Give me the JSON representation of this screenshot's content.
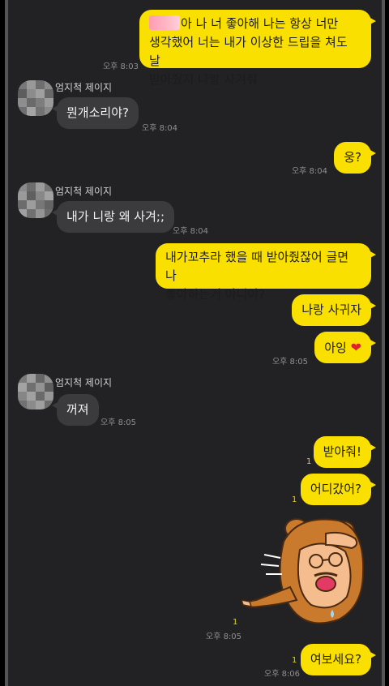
{
  "contact": {
    "name": "엄지척 제이지"
  },
  "messages": [
    {
      "id": "m1",
      "side": "me",
      "lines": [
        "아 나 너 좋아해 나는 항상 너만",
        "생각했어 너는 내가 이상한 드립을 쳐도 날",
        "받아줬지 나랑 사겨줘"
      ],
      "time": "오후 8:03"
    },
    {
      "id": "m2",
      "side": "them",
      "text": "뭔개소리야?",
      "time": "오후 8:04"
    },
    {
      "id": "m3",
      "side": "me",
      "text": "웅?",
      "time": "오후 8:04"
    },
    {
      "id": "m4",
      "side": "them",
      "text": "내가 니랑 왜 사겨;;",
      "time": "오후 8:04"
    },
    {
      "id": "m5",
      "side": "me",
      "lines": [
        "내가꼬추라 했을 때 받아줬잖어 글면 나",
        "좋아하는거 아니야?"
      ]
    },
    {
      "id": "m6",
      "side": "me",
      "text": "나랑 사귀자"
    },
    {
      "id": "m7",
      "side": "me",
      "text": "아잉",
      "emoji": "❤",
      "time": "오후 8:05"
    },
    {
      "id": "m8",
      "side": "them",
      "text": "꺼져",
      "time": "오후 8:05"
    },
    {
      "id": "m9",
      "side": "me",
      "text": "받아줘!",
      "unread": "1"
    },
    {
      "id": "m10",
      "side": "me",
      "text": "어디갔어?",
      "unread": "1"
    },
    {
      "id": "m11",
      "side": "me",
      "type": "sticker",
      "sticker": "bear-costume-man-sticker",
      "unread": "1",
      "time": "오후 8:05"
    },
    {
      "id": "m12",
      "side": "me",
      "text": "여보세요?",
      "unread": "1",
      "time": "오후 8:06"
    }
  ],
  "colors": {
    "my_bubble": "#f9e000",
    "their_bubble": "#3b3b3e",
    "background": "#222224",
    "unread": "#e9cf00"
  }
}
